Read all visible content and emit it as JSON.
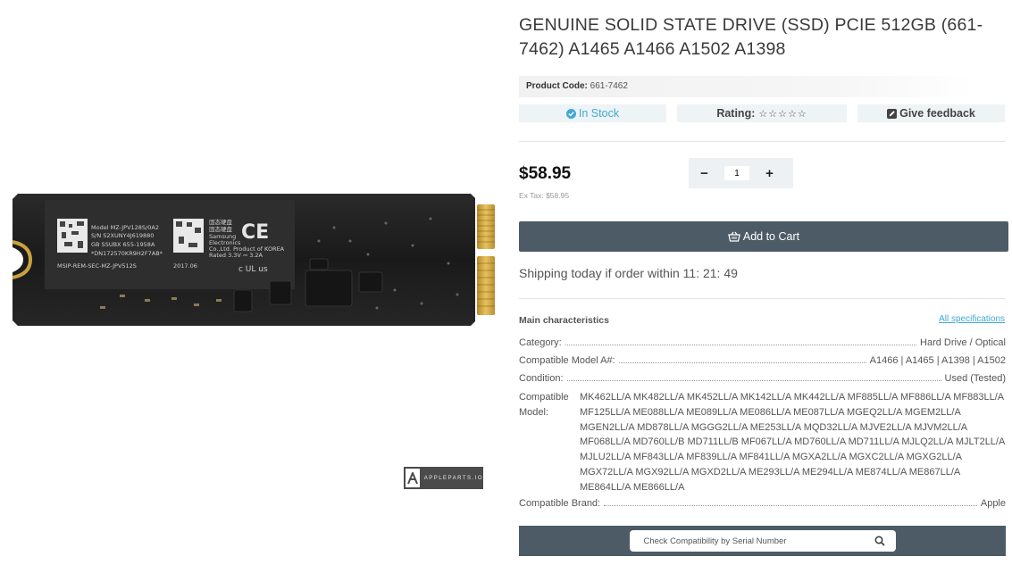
{
  "product": {
    "title": "GENUINE SOLID STATE DRIVE (SSD) PCIE 512GB (661-7462) A1465 A1466 A1502 A1398",
    "code_label": "Product Code:",
    "code_value": "661-7462",
    "stock": "In Stock",
    "rating_label": "Rating:",
    "rating_stars": "☆☆☆☆☆",
    "feedback_label": "Give feedback",
    "price": "$58.95",
    "ex_tax": "Ex Tax: $58.95",
    "quantity": "1",
    "minus": "−",
    "plus": "+",
    "add_to_cart": "Add to Cart",
    "shipping": "Shipping today if order within 11: 21: 49"
  },
  "image": {
    "label_text": {
      "model": "Model  MZ-JPV128S/0A2",
      "sn": "S/N  S2XUNY4J619880",
      "gb": "GB SSUBX   655-1958A",
      "dn": "*DN172570KR9H2F7AB*",
      "part": "MSIP-REM-SEC-MZ-JPV512S",
      "cn": "固态硬盘",
      "cn2": "固态硬盘",
      "maker1": "Samsung",
      "maker2": "Electronics",
      "maker3": "Co.,Ltd.  Product of KOREA",
      "rated": "Rated  3.3V ⎓ 3.2A",
      "date": "2017.06",
      "ce": "CE",
      "ul": "c UL us"
    },
    "brand_logo": "APPLEPARTS.IO"
  },
  "characteristics": {
    "heading": "Main characteristics",
    "all_link": "All specifications",
    "rows": [
      {
        "label": "Category:",
        "value": "Hard Drive / Optical"
      },
      {
        "label": "Compatible Model A#:",
        "value": "A1466 | A1465 | A1398 | A1502"
      },
      {
        "label": "Condition:",
        "value": "Used (Tested)"
      }
    ],
    "models_label": "Compatible Model:",
    "models_value": "MK462LL/A MK482LL/A MK452LL/A MK142LL/A MK442LL/A MF885LL/A MF886LL/A MF883LL/A MF125LL/A ME088LL/A ME089LL/A ME086LL/A ME087LL/A MGEQ2LL/A MGEM2LL/A MGEN2LL/A MD878LL/A MGGG2LL/A ME253LL/A MQD32LL/A MJVE2LL/A MJVM2LL/A MF068LL/A MD760LL/B MD711LL/B MF067LL/A MD760LL/A MD711LL/A MJLQ2LL/A MJLT2LL/A MJLU2LL/A MF843LL/A MF839LL/A MF841LL/A MGXA2LL/A MGXC2LL/A MGXG2LL/A MGX72LL/A MGX92LL/A MGXD2LL/A ME293LL/A ME294LL/A ME874LL/A ME867LL/A ME864LL/A ME866LL/A",
    "brand": {
      "label": "Compatible Brand:",
      "value": "Apple"
    }
  },
  "serial_search": {
    "placeholder": "Check Compatibility by Serial Number"
  },
  "colors": {
    "accent": "#3fa9d8",
    "button": "#4d5b67",
    "pill": "#eef3f6"
  },
  "icons": [
    "check-circle-icon",
    "star-icon",
    "edit-icon",
    "cart-icon",
    "search-icon",
    "brand-logo-icon"
  ]
}
